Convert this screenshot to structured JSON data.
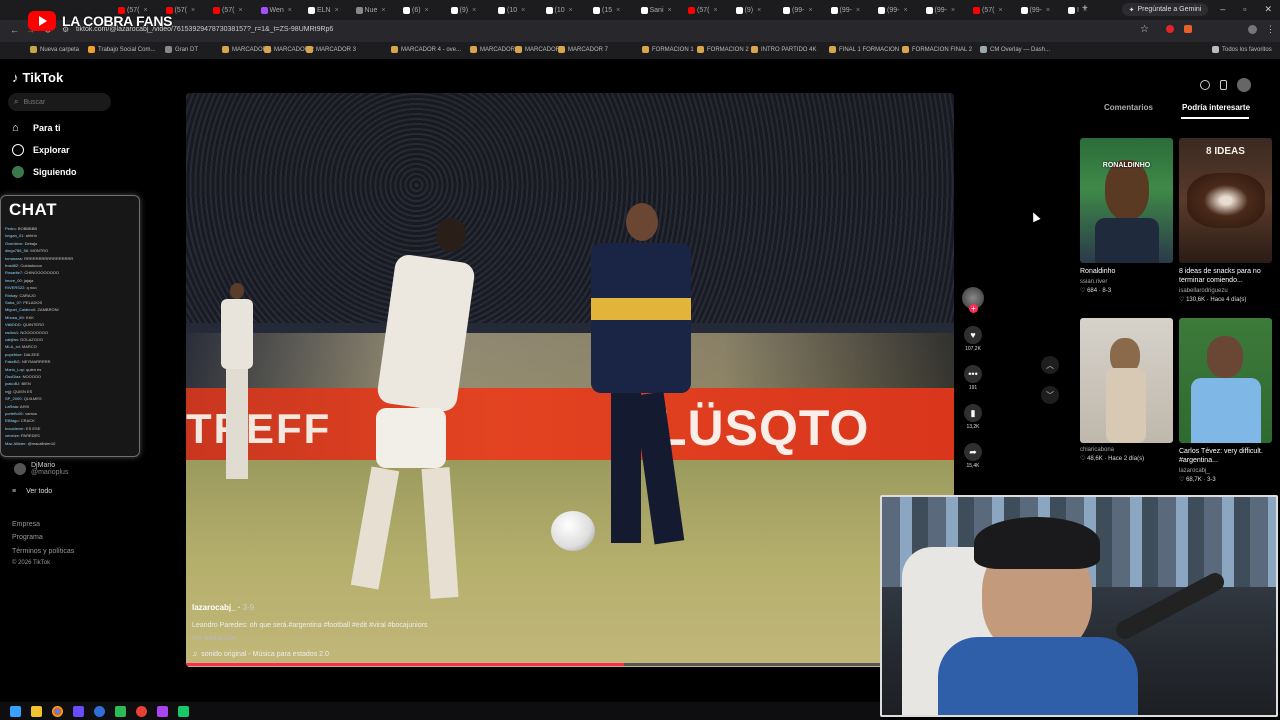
{
  "stream": {
    "title": "LA COBRA FANS"
  },
  "browser": {
    "url": "tiktok.com/@lazarocabj_/video/7615392947873038157?_r=1&_t=ZS-98UMRt9Rp6",
    "gemini_button": "Pregúntale a Gemini",
    "tabs": [
      "(57(",
      "(57(",
      "(57(",
      "Wen",
      "ELN",
      "Nue",
      "(6)",
      "(9)",
      "(10",
      "(10",
      "(15",
      "Sani",
      "(57(",
      "(9)",
      "(99-",
      "(99-",
      "(99-",
      "(99-",
      "(57(",
      "(99-",
      "I"
    ],
    "bookmarks": [
      "Nueva carpeta",
      "Trabajo Social Com...",
      "Gran DT",
      "MARCADOR 1",
      "MARCADOR 2",
      "MARCADOR 3",
      "MARCADOR 4 - ove...",
      "MARCADOR 5",
      "MARCADOR 6",
      "MARCADOR 7",
      "FORMACION 1",
      "FORMACION 2",
      "INTRO PARTIDO 4K",
      "FINAL 1 FORMACION",
      "FORMACION FINAL 2",
      "CM Overlay — Dash..."
    ],
    "bookmarks_all": "Todos los favoritos"
  },
  "tiktok": {
    "logo": "TikTok",
    "search_placeholder": "Buscar",
    "nav": [
      "Para ti",
      "Explorar",
      "Siguiendo"
    ],
    "following_user": {
      "name": "DjMario",
      "handle": "@marioplus"
    },
    "see_all": "Ver todo",
    "footer": [
      "Empresa",
      "Programa",
      "Términos y políticas",
      "© 2026 TikTok"
    ]
  },
  "chat": {
    "title": "CHAT",
    "lines": [
      {
        "user": "Pedro",
        "text": "BOBBBBB"
      },
      {
        "user": "lovgan_01",
        "text": "ahhhh"
      },
      {
        "user": "Overdrive",
        "text": "Debajo"
      },
      {
        "user": "diego786_56",
        "text": "MONTRO"
      },
      {
        "user": "tomassss",
        "text": "RRRRRRRRRRRRRRRRR"
      },
      {
        "user": "frosti82",
        "text": "Cuidadoooo"
      },
      {
        "user": "Rosarite7",
        "text": "CHINOOOOOOOO"
      },
      {
        "user": "lmore_00",
        "text": "jajaja"
      },
      {
        "user": "RIVERS22",
        "text": "q noo"
      },
      {
        "user": "Rinkay",
        "text": "CARAJO"
      },
      {
        "user": "Saba_07",
        "text": "PELADOS"
      },
      {
        "user": "Miguel_Calabro0",
        "text": "ZAMBRONI"
      },
      {
        "user": "Mhosa_89",
        "text": "KKK"
      },
      {
        "user": "ViiiiiDDD",
        "text": "QUINTERO"
      },
      {
        "user": "radios1",
        "text": "NOOOOOOOO"
      },
      {
        "user": "cabjfan",
        "text": "GOLAZOOO"
      },
      {
        "user": "MLA_xd",
        "text": "MARCO"
      },
      {
        "user": "popeblue",
        "text": "DALEEE"
      },
      {
        "user": "FakeBG",
        "text": "NEYMARRRRR"
      },
      {
        "user": "Mario_Lop",
        "text": "quien es"
      },
      {
        "user": "OsoDiaz",
        "text": "NOOOOO"
      },
      {
        "user": "joakoBJ",
        "text": "BIEN"
      },
      {
        "user": "mjjj",
        "text": "QUIEN ES"
      },
      {
        "user": "SP_2000",
        "text": "QUILMES"
      },
      {
        "user": "LaRata",
        "text": "AHIII"
      },
      {
        "user": "porteño01",
        "text": "vamos"
      },
      {
        "user": "ElMago",
        "text": "CRACK"
      },
      {
        "user": "boca4ever",
        "text": "ES ESE"
      },
      {
        "user": "xeneize",
        "text": "PAREDES"
      },
      {
        "user": "Mac Allister",
        "text": "@macallister10"
      }
    ]
  },
  "video": {
    "banner_left": "TREFF",
    "banner_right": "LÜSQTO",
    "author": "lazarocabj_",
    "date": "3-9",
    "caption": "Leandro Paredes: oh que será.#argentina #football #edit #viral #bocajuniors",
    "translate": "Ver traducción",
    "sound": "sonido original - Música para estados 2.0",
    "progress": 0.57
  },
  "actions": {
    "likes": "107,2K",
    "comments": "191",
    "saves": "13,2K",
    "shares": "15,4K"
  },
  "right_panel": {
    "tabs": [
      "Comentarios",
      "Podría interesarte"
    ],
    "cards": [
      {
        "overlay": "RONALDINHO",
        "title": "Ronaldinho",
        "author": "ssian.river",
        "meta": "684 · 8-3"
      },
      {
        "overlay": "8 IDEAS",
        "title": "8 ideas de snacks para no terminar comiendo...",
        "author": "isabellarodriguezu",
        "meta": "130,6K · Hace 4 día(s)"
      },
      {
        "overlay": "",
        "title": "",
        "author": "chiaricabona",
        "meta": "48,6K · Hace 2 día(s)"
      },
      {
        "overlay": "",
        "title": "Carlos Tévez: very difficult. #argentina...",
        "author": "lazarocabj_",
        "meta": "68,7K · 3-3"
      }
    ]
  },
  "colors": {
    "accent": "#fe2c55",
    "youtube": "#ff0000"
  }
}
